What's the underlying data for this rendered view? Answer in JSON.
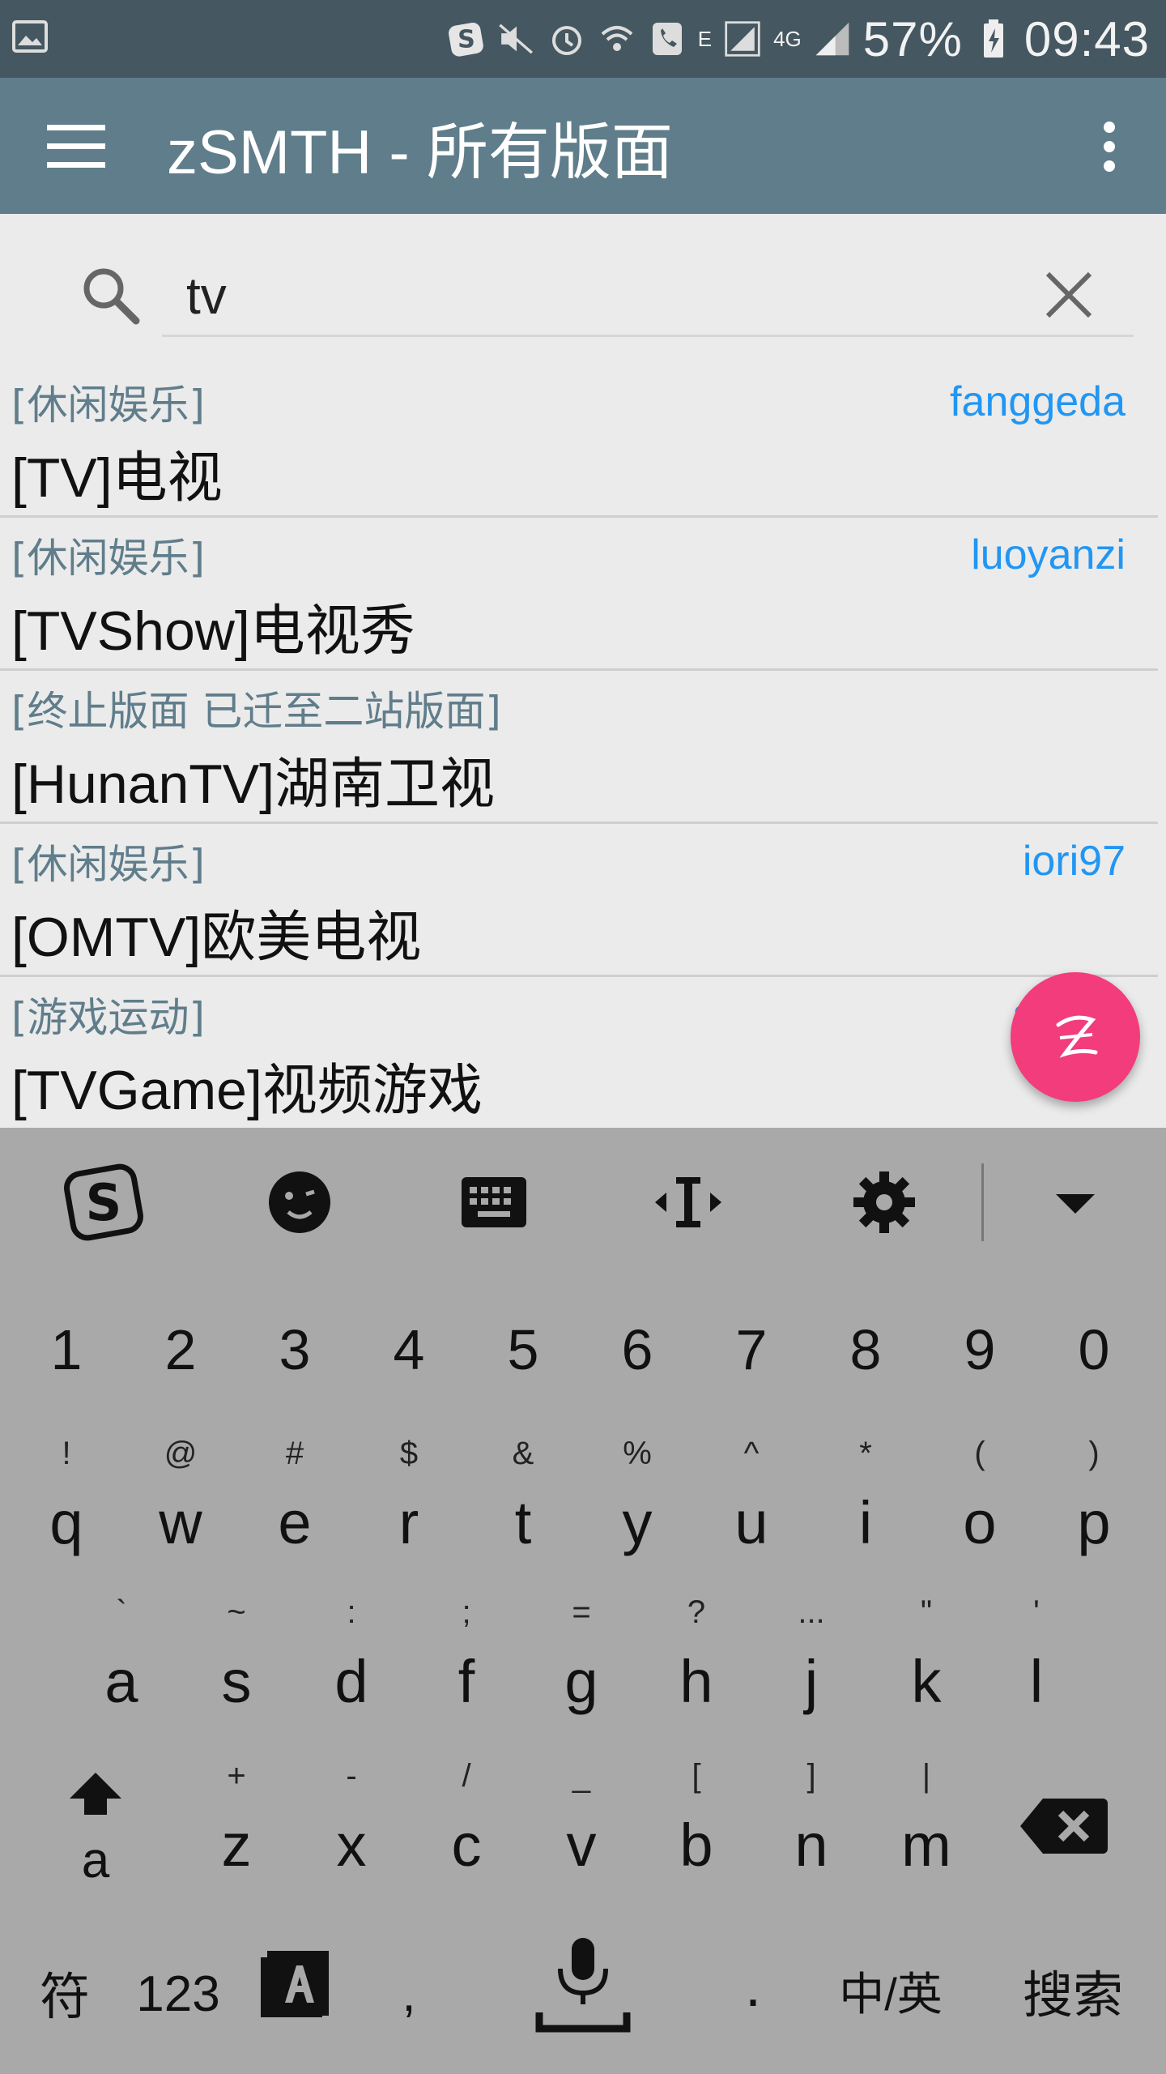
{
  "status_bar": {
    "battery": "57%",
    "time": "09:43",
    "network_e": "E",
    "network_4g": "4G",
    "icons": [
      "gallery-icon",
      "sogou-icon",
      "mute-icon",
      "alarm-icon",
      "wifi-calling-icon",
      "call-icon",
      "signal-icon",
      "battery-charging-icon"
    ]
  },
  "toolbar": {
    "title": "zSMTH - 所有版面"
  },
  "search": {
    "value": "tv",
    "placeholder": ""
  },
  "boards": [
    {
      "category": "[休闲娱乐]",
      "moderator": "fanggeda",
      "title": "[TV]电视"
    },
    {
      "category": "[休闲娱乐]",
      "moderator": "luoyanzi",
      "title": "[TVShow]电视秀"
    },
    {
      "category": "[终止版面 已迁至二站版面]",
      "moderator": "",
      "title": "[HunanTV]湖南卫视"
    },
    {
      "category": "[休闲娱乐]",
      "moderator": "iori97",
      "title": "[OMTV]欧美电视"
    },
    {
      "category": "[游戏运动]",
      "moderator": "sucha",
      "title": "[TVGame]视频游戏"
    }
  ],
  "keyboard": {
    "numbers": [
      "1",
      "2",
      "3",
      "4",
      "5",
      "6",
      "7",
      "8",
      "9",
      "0"
    ],
    "row1": [
      {
        "main": "q",
        "sub": "!"
      },
      {
        "main": "w",
        "sub": "@"
      },
      {
        "main": "e",
        "sub": "#"
      },
      {
        "main": "r",
        "sub": "$"
      },
      {
        "main": "t",
        "sub": "&"
      },
      {
        "main": "y",
        "sub": "%"
      },
      {
        "main": "u",
        "sub": "^"
      },
      {
        "main": "i",
        "sub": "*"
      },
      {
        "main": "o",
        "sub": "("
      },
      {
        "main": "p",
        "sub": ")"
      }
    ],
    "row2": [
      {
        "main": "a",
        "sub": "`"
      },
      {
        "main": "s",
        "sub": "~"
      },
      {
        "main": "d",
        "sub": ":"
      },
      {
        "main": "f",
        "sub": ";"
      },
      {
        "main": "g",
        "sub": "="
      },
      {
        "main": "h",
        "sub": "?"
      },
      {
        "main": "j",
        "sub": "..."
      },
      {
        "main": "k",
        "sub": "\""
      },
      {
        "main": "l",
        "sub": "'"
      }
    ],
    "row3": [
      {
        "main": "z",
        "sub": "+"
      },
      {
        "main": "x",
        "sub": "-"
      },
      {
        "main": "c",
        "sub": "/"
      },
      {
        "main": "v",
        "sub": "_"
      },
      {
        "main": "b",
        "sub": "["
      },
      {
        "main": "n",
        "sub": "]"
      },
      {
        "main": "m",
        "sub": "|"
      }
    ],
    "shift_label": "a",
    "symbols_label": "符",
    "numbers_label": "123",
    "comma_label": ",",
    "period_label": ".",
    "lang_label": "中/英",
    "search_label": "搜索"
  },
  "colors": {
    "status_bar": "#455760",
    "toolbar": "#5f7d8a",
    "accent": "#2196f3",
    "fab": "#f23c7b"
  }
}
